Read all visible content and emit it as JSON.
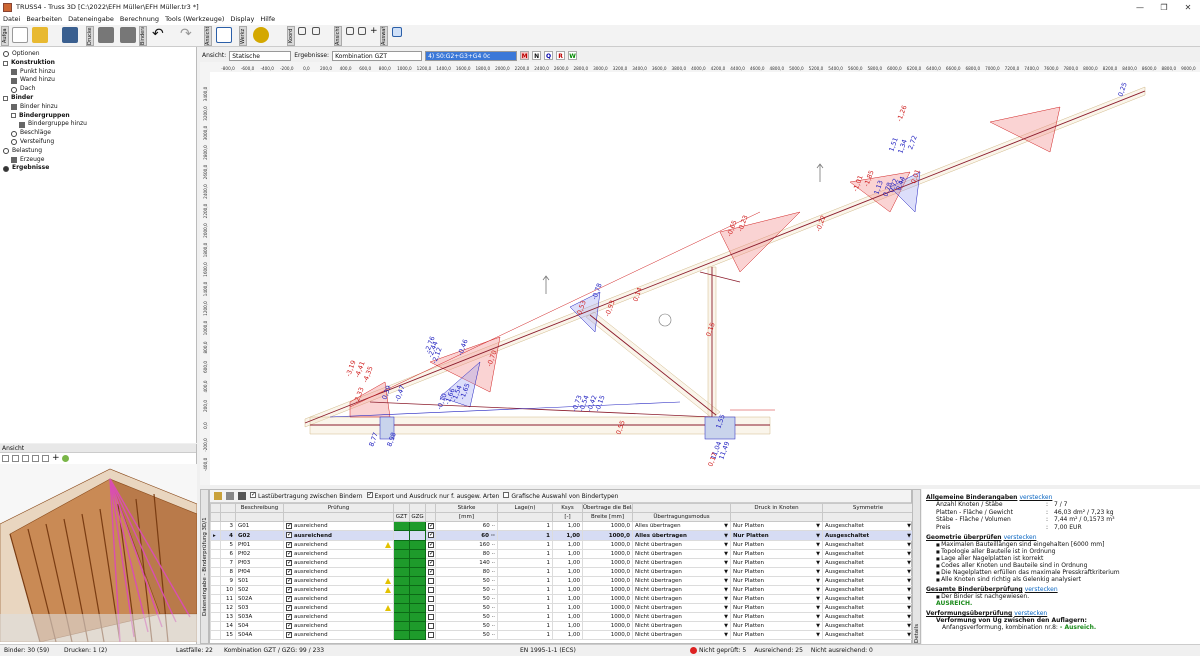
{
  "window": {
    "title": "TRUSS4 - Truss 3D [C:\\2022\\EFH Müller\\EFH Müller.tr3 *]"
  },
  "menu": [
    "Datei",
    "Bearbeiten",
    "Dateneingabe",
    "Berechnung",
    "Tools (Werkzeuge)",
    "Display",
    "Hilfe"
  ],
  "toolbar_groups": [
    "Aufga",
    "Drucken",
    "Bindera",
    "Ansicht",
    "Werkz",
    "Koord",
    "Ansicht",
    "Auswahl"
  ],
  "view_bar": {
    "ansicht_label": "Ansicht:",
    "ansicht_value": "Statische Berechnung",
    "ergebnisse_label": "Ergebnisse:",
    "ergebnisse_value": "Kombination GZT",
    "combo_value": "4) S0:G2+G3+G4 0c",
    "buttons": [
      "M",
      "N",
      "Q",
      "R",
      "W"
    ]
  },
  "tree": [
    {
      "label": "Optionen",
      "kind": "radio",
      "level": 0,
      "bold": false,
      "on": false
    },
    {
      "label": "Konstruktion",
      "kind": "box",
      "level": 0,
      "bold": true,
      "on": false
    },
    {
      "label": "Punkt hinzu",
      "kind": "icon",
      "level": 1,
      "bold": false,
      "on": false
    },
    {
      "label": "Wand hinzu",
      "kind": "icon",
      "level": 1,
      "bold": false,
      "on": false
    },
    {
      "label": "Dach",
      "kind": "radio",
      "level": 1,
      "bold": false,
      "on": false
    },
    {
      "label": "Binder",
      "kind": "box",
      "level": 0,
      "bold": true,
      "on": false
    },
    {
      "label": "Binder hinzu",
      "kind": "icon",
      "level": 1,
      "bold": false,
      "on": false
    },
    {
      "label": "Bindergruppen",
      "kind": "box",
      "level": 1,
      "bold": true,
      "on": false
    },
    {
      "label": "Bindergruppe hinzu",
      "kind": "icon",
      "level": 2,
      "bold": false,
      "on": false
    },
    {
      "label": "Beschläge",
      "kind": "radio",
      "level": 1,
      "bold": false,
      "on": false
    },
    {
      "label": "Versteifung",
      "kind": "radio",
      "level": 1,
      "bold": false,
      "on": false
    },
    {
      "label": "Belastung",
      "kind": "radio",
      "level": 0,
      "bold": false,
      "on": false
    },
    {
      "label": "Erzeuge",
      "kind": "icon",
      "level": 1,
      "bold": false,
      "on": false
    },
    {
      "label": "Ergebnisse",
      "kind": "radio",
      "level": 0,
      "bold": true,
      "on": true
    }
  ],
  "view_panel": {
    "title": "Ansicht"
  },
  "ruler_top": [
    "-800,0",
    "-600,0",
    "-400,0",
    "-200,0",
    "0,0",
    "200,0",
    "400,0",
    "600,0",
    "800,0",
    "1000,0",
    "1200,0",
    "1400,0",
    "1600,0",
    "1800,0",
    "2000,0",
    "2200,0",
    "2400,0",
    "2600,0",
    "2800,0",
    "3000,0",
    "3200,0",
    "3400,0",
    "3600,0",
    "3800,0",
    "4000,0",
    "4200,0",
    "4400,0",
    "4600,0",
    "4800,0",
    "5000,0",
    "5200,0",
    "5400,0",
    "5600,0",
    "5800,0",
    "6000,0",
    "6200,0",
    "6400,0",
    "6600,0",
    "6800,0",
    "7000,0",
    "7200,0",
    "7400,0",
    "7600,0",
    "7800,0",
    "8000,0",
    "8200,0",
    "8400,0",
    "8600,0",
    "8800,0",
    "9000,0"
  ],
  "ruler_left": [
    "3400,0",
    "3200,0",
    "3000,0",
    "2800,0",
    "2600,0",
    "2400,0",
    "2200,0",
    "2000,0",
    "1800,0",
    "1600,0",
    "1400,0",
    "1200,0",
    "1000,0",
    "800,0",
    "600,0",
    "400,0",
    "200,0",
    "0,0",
    "-200,0",
    "-400,0"
  ],
  "diagram_labels": {
    "blue": [
      "-2,12",
      "-2,44",
      "-2,76",
      "-0,46",
      "0,39",
      "-0,47",
      "-0,10",
      "-1,66",
      "-1,54",
      "-1,65",
      "-0,73",
      "-0,54",
      "-0,42",
      "-0,15",
      "8,77",
      "8,98",
      "11,04",
      "11,49",
      "1,51",
      "1,34",
      "2,72",
      "1,13",
      "0,78",
      "0,72",
      "0,44",
      "0,25",
      "-0,78",
      "1,55"
    ],
    "red": [
      "-3,19",
      "-4,41",
      "-4,35",
      "-2,33",
      "-0,70",
      "0,55",
      "0,14",
      "0,15",
      "-0,22",
      "0,01",
      "0,53",
      "-0,93",
      "0,17",
      "-1,26",
      "-1,85",
      "-1,01",
      "-0,65",
      "-0,23"
    ]
  },
  "table": {
    "toolbar": [
      {
        "label": "Lastübertragung zwischen Bindern",
        "checked": true
      },
      {
        "label": "Export und Ausdruck nur f. ausgew. Arten",
        "checked": true
      },
      {
        "label": "Grafische Auswahl von Bindertypen",
        "checked": false
      }
    ],
    "header_top": [
      "",
      "",
      "Beschreibung",
      "Prüfung",
      "",
      "",
      "",
      "Stärke",
      "Lage(n)",
      "Ksys",
      "Übertrage die Belastung von der Dachfläche",
      "",
      "Druck in Knoten",
      "Symmetrie"
    ],
    "header_sub": [
      "",
      "",
      "",
      "",
      "GZT",
      "GZG",
      "",
      "[mm]",
      "",
      "[-]",
      "Breite [mm]",
      "Übertragungsmodus",
      "",
      ""
    ],
    "rows": [
      {
        "n": "3",
        "name": "G01",
        "pr": "ausreichend",
        "warn": false,
        "c": true,
        "st": "60",
        "lg": "1",
        "k": "1,00",
        "br": "1000,0",
        "mode": "Alles übertragen",
        "dr": "Nur Platten",
        "sym": "Ausgeschaltet",
        "sel": false
      },
      {
        "n": "4",
        "name": "G02",
        "pr": "ausreichend",
        "warn": false,
        "c": true,
        "st": "60",
        "lg": "1",
        "k": "1,00",
        "br": "1000,0",
        "mode": "Alles übertragen",
        "dr": "Nur Platten",
        "sym": "Ausgeschaltet",
        "sel": true
      },
      {
        "n": "5",
        "name": "Pf01",
        "pr": "ausreichend",
        "warn": true,
        "c": true,
        "st": "160",
        "lg": "1",
        "k": "1,00",
        "br": "1000,0",
        "mode": "Nicht übertragen",
        "dr": "Nur Platten",
        "sym": "Ausgeschaltet",
        "sel": false
      },
      {
        "n": "6",
        "name": "Pf02",
        "pr": "ausreichend",
        "warn": false,
        "c": true,
        "st": "80",
        "lg": "1",
        "k": "1,00",
        "br": "1000,0",
        "mode": "Nicht übertragen",
        "dr": "Nur Platten",
        "sym": "Ausgeschaltet",
        "sel": false
      },
      {
        "n": "7",
        "name": "Pf03",
        "pr": "ausreichend",
        "warn": false,
        "c": true,
        "st": "140",
        "lg": "1",
        "k": "1,00",
        "br": "1000,0",
        "mode": "Nicht übertragen",
        "dr": "Nur Platten",
        "sym": "Ausgeschaltet",
        "sel": false
      },
      {
        "n": "8",
        "name": "Pf04",
        "pr": "ausreichend",
        "warn": false,
        "c": true,
        "st": "80",
        "lg": "1",
        "k": "1,00",
        "br": "1000,0",
        "mode": "Nicht übertragen",
        "dr": "Nur Platten",
        "sym": "Ausgeschaltet",
        "sel": false
      },
      {
        "n": "9",
        "name": "S01",
        "pr": "ausreichend",
        "warn": true,
        "c": false,
        "st": "50",
        "lg": "1",
        "k": "1,00",
        "br": "1000,0",
        "mode": "Nicht übertragen",
        "dr": "Nur Platten",
        "sym": "Ausgeschaltet",
        "sel": false
      },
      {
        "n": "10",
        "name": "S02",
        "pr": "ausreichend",
        "warn": true,
        "c": false,
        "st": "50",
        "lg": "1",
        "k": "1,00",
        "br": "1000,0",
        "mode": "Nicht übertragen",
        "dr": "Nur Platten",
        "sym": "Ausgeschaltet",
        "sel": false
      },
      {
        "n": "11",
        "name": "S02A",
        "pr": "ausreichend",
        "warn": false,
        "c": false,
        "st": "50",
        "lg": "1",
        "k": "1,00",
        "br": "1000,0",
        "mode": "Nicht übertragen",
        "dr": "Nur Platten",
        "sym": "Ausgeschaltet",
        "sel": false
      },
      {
        "n": "12",
        "name": "S03",
        "pr": "ausreichend",
        "warn": true,
        "c": false,
        "st": "50",
        "lg": "1",
        "k": "1,00",
        "br": "1000,0",
        "mode": "Nicht übertragen",
        "dr": "Nur Platten",
        "sym": "Ausgeschaltet",
        "sel": false
      },
      {
        "n": "13",
        "name": "S03A",
        "pr": "ausreichend",
        "warn": false,
        "c": false,
        "st": "50",
        "lg": "1",
        "k": "1,00",
        "br": "1000,0",
        "mode": "Nicht übertragen",
        "dr": "Nur Platten",
        "sym": "Ausgeschaltet",
        "sel": false
      },
      {
        "n": "14",
        "name": "S04",
        "pr": "ausreichend",
        "warn": false,
        "c": false,
        "st": "50",
        "lg": "1",
        "k": "1,00",
        "br": "1000,0",
        "mode": "Nicht übertragen",
        "dr": "Nur Platten",
        "sym": "Ausgeschaltet",
        "sel": false
      },
      {
        "n": "15",
        "name": "S04A",
        "pr": "ausreichend",
        "warn": false,
        "c": false,
        "st": "50",
        "lg": "1",
        "k": "1,00",
        "br": "1000,0",
        "mode": "Nicht übertragen",
        "dr": "Nur Platten",
        "sym": "Ausgeschaltet",
        "sel": false
      }
    ]
  },
  "side_tabs": {
    "left": "Dateneingabe - Binderprüfung 3D/1",
    "right": "Details"
  },
  "info": {
    "h1": "Allgemeine Binderangaben",
    "h1_link": "verstecken",
    "rows": [
      [
        "Anzahl Knoten / Stäbe",
        "7 / 7"
      ],
      [
        "Platten - Fläche / Gewicht",
        "46,03 dm² / 7,23 kg"
      ],
      [
        "Stäbe - Fläche / Volumen",
        "7,44 m² / 0,1573 m³"
      ],
      [
        "Preis",
        "7,00 EUR"
      ]
    ],
    "h2": "Geometrie überprüfen",
    "h2_link": "verstecken",
    "bullets": [
      "Maximalen Bauteillängen sind eingehalten [6000 mm]",
      "Topologie aller Bauteile ist in Ordnung",
      "Lage aller Nagelplatten ist korrekt",
      "Codes aller Knoten und Bauteile sind in Ordnung",
      "Die Nagelplatten erfüllen das maximale Presskraftkriterium",
      "Alle Knoten sind richtig als Gelenkig analysiert"
    ],
    "h3": "Gesamte Binderüberprüfung",
    "h3_link": "verstecken",
    "bullet3": "Der Binder ist nachgewiesen.",
    "ok": "AUSREICH.",
    "h4": "Verformungsüberprüfung",
    "h4_link": "verstecken",
    "def_line": "Verformung von Ug zwischen den Auflagern:",
    "def_sub": "Anfangsverformung, kombination nr.8:",
    "def_ok": "- Ausreich."
  },
  "status": {
    "binder": "Binder: 30 (59)",
    "drucken": "Drucken: 1 (2)",
    "lastfaelle": "Lastfälle: 22",
    "kombination": "Kombination GZT / GZG: 99 / 233",
    "norm": "EN 1995-1-1 (ECS)",
    "nicht_geprueft": "Nicht geprüft: 5",
    "ausreichend": "Ausreichend: 25",
    "nicht_ausreichend": "Nicht ausreichend: 0"
  },
  "colors": {
    "accent": "#3b78d8",
    "ok_green": "#1e9b2b",
    "load_red": "#d02020",
    "load_blue": "#2020c0",
    "member": "#8b1c2c"
  }
}
